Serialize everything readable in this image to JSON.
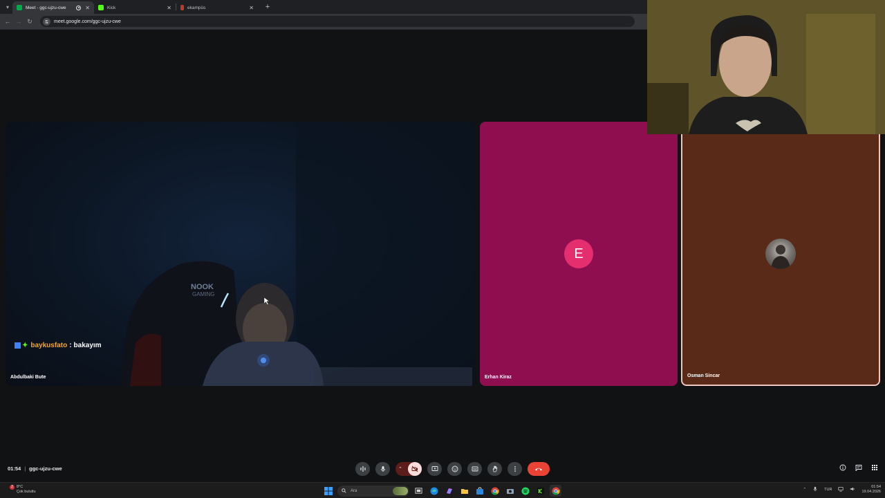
{
  "browser": {
    "tabs": [
      {
        "title": "Meet - ggc-ujzu-cwe",
        "favicon_color": "#00ac47",
        "active": true,
        "recording": true
      },
      {
        "title": "Kick",
        "favicon_color": "#53fc18",
        "active": false,
        "recording": false
      },
      {
        "title": "ekampüs",
        "favicon_color": "#c0392b",
        "active": false,
        "recording": false
      }
    ],
    "url": "meet.google.com/ggc-ujzu-cwe"
  },
  "meet": {
    "tiles": [
      {
        "name": "Abdulbaki Bute"
      },
      {
        "name": "Erhan Kiraz",
        "initial": "E"
      },
      {
        "name": "Osman Sincar"
      }
    ],
    "chat_overlay": {
      "user": "baykusfato",
      "separator": ":",
      "message": "bakayım"
    },
    "bottom_bar": {
      "time": "01:54",
      "separator": "|",
      "meeting_code": "ggc-ujzu-cwe"
    },
    "colors": {
      "erhan_tile": "#8e0e4f",
      "osman_tile": "#5a2a19",
      "end_call": "#ea4335"
    }
  },
  "taskbar": {
    "weather": {
      "temp": "8°C",
      "condition": "Çok bulutlu",
      "badge": "2"
    },
    "search_placeholder": "Ara",
    "tray": {
      "lang": "TUR",
      "time": "01:54",
      "date": "19.04.2026"
    }
  }
}
